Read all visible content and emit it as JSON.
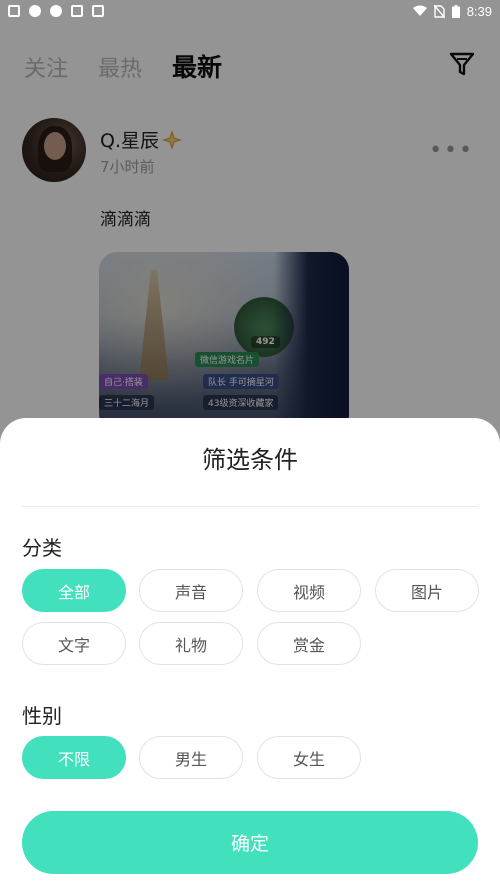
{
  "status_bar": {
    "time": "8:39"
  },
  "feed": {
    "tabs": [
      {
        "label": "关注"
      },
      {
        "label": "最热"
      },
      {
        "label": "最新",
        "active": true
      }
    ],
    "post": {
      "username": "Q.星辰",
      "time_ago": "7小时前",
      "text": "滴滴滴",
      "image_texts": {
        "like_count": "492",
        "wechat_card": "微信游戏名片",
        "outfit": "自己·搭装",
        "team": "队长 手可摘星河",
        "name_line": "三十二海月",
        "level_line": "43级资深收藏家"
      }
    }
  },
  "filter_sheet": {
    "title": "筛选条件",
    "category_label": "分类",
    "categories": [
      {
        "label": "全部",
        "selected": true
      },
      {
        "label": "声音",
        "selected": false
      },
      {
        "label": "视频",
        "selected": false
      },
      {
        "label": "图片",
        "selected": false
      },
      {
        "label": "文字",
        "selected": false
      },
      {
        "label": "礼物",
        "selected": false
      },
      {
        "label": "赏金",
        "selected": false
      }
    ],
    "gender_label": "性别",
    "genders": [
      {
        "label": "不限",
        "selected": true
      },
      {
        "label": "男生",
        "selected": false
      },
      {
        "label": "女生",
        "selected": false
      }
    ],
    "confirm_label": "确定"
  },
  "colors": {
    "accent": "#43e0bd",
    "chip_border": "#e3e3e3",
    "text_primary": "#222222",
    "text_muted": "#a0a0a0"
  },
  "icons": {
    "filter": "filter-funnel-icon",
    "more": "more-dots-icon",
    "verified": "sparkle-badge-icon"
  }
}
